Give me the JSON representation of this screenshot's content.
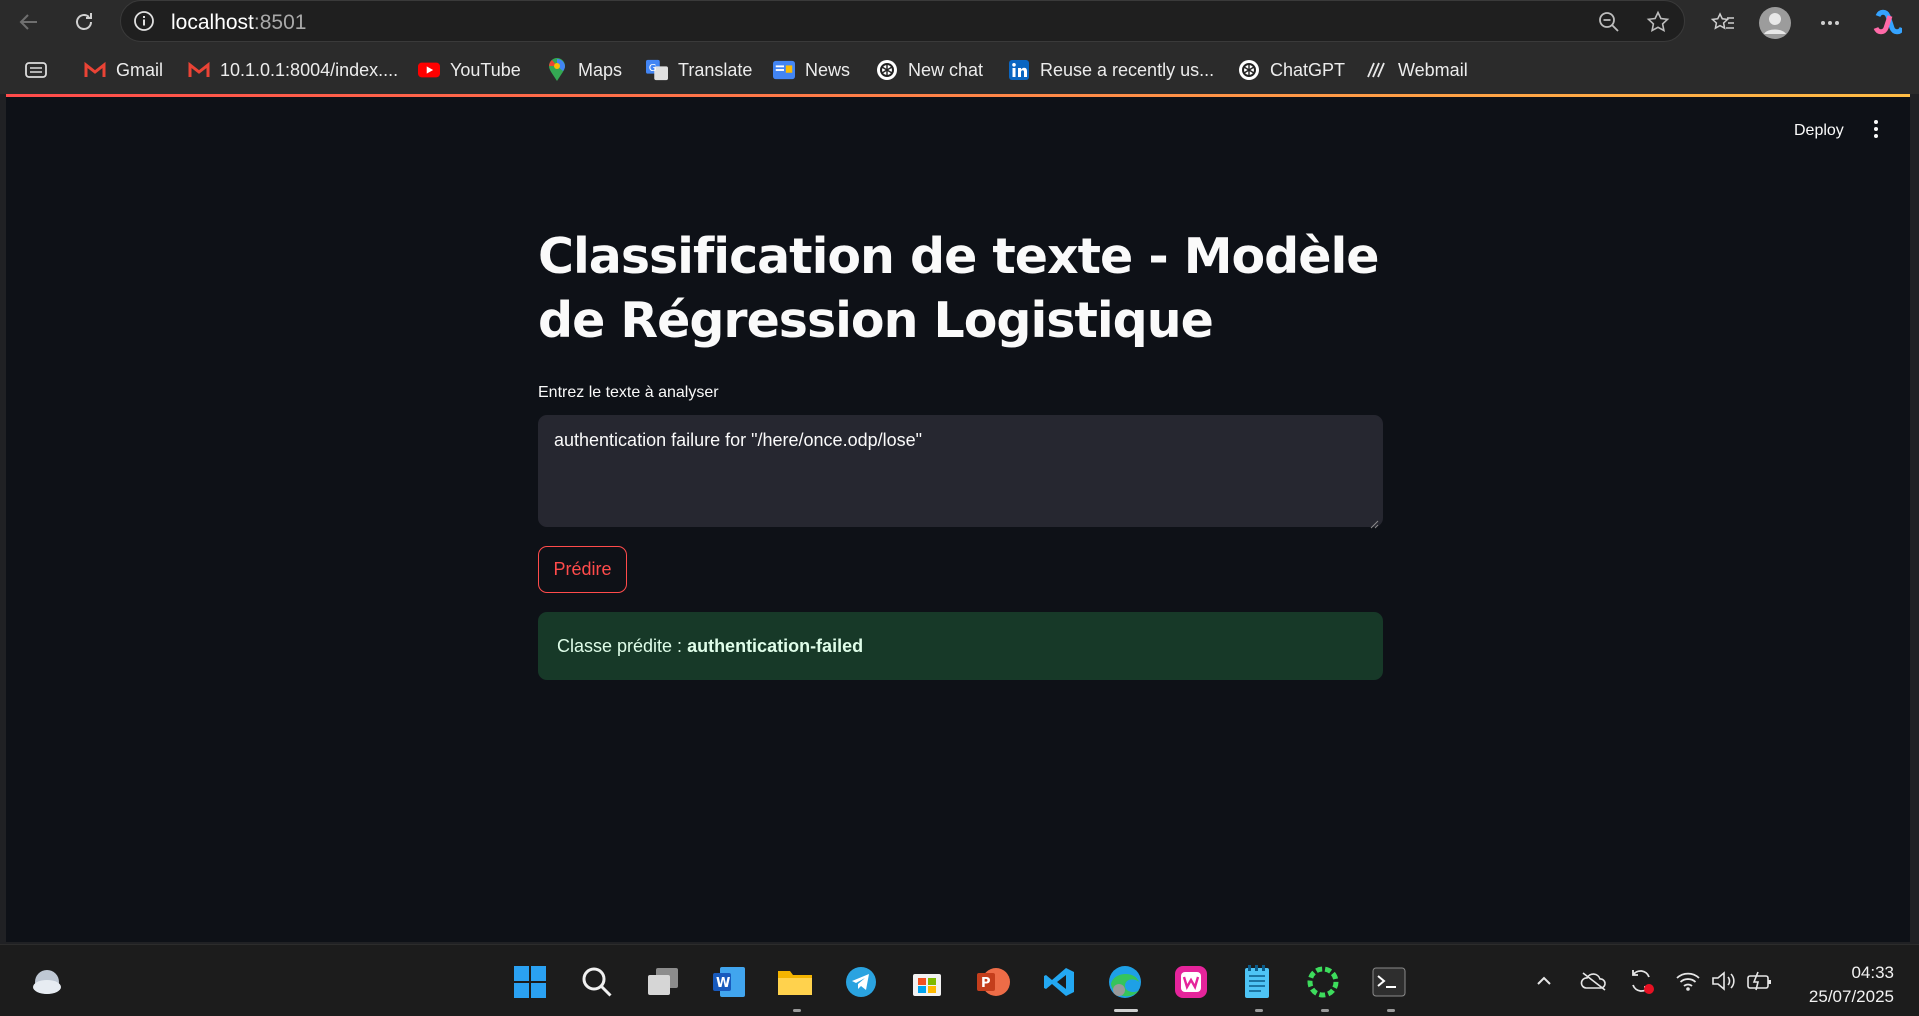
{
  "browser": {
    "url_host": "localhost",
    "url_port": ":8501"
  },
  "bookmarks": [
    {
      "label": "Gmail",
      "icon": "gmail-icon"
    },
    {
      "label": "10.1.0.1:8004/index....",
      "icon": "gmail-icon"
    },
    {
      "label": "YouTube",
      "icon": "youtube-icon"
    },
    {
      "label": "Maps",
      "icon": "maps-icon"
    },
    {
      "label": "Translate",
      "icon": "translate-icon"
    },
    {
      "label": "News",
      "icon": "news-icon"
    },
    {
      "label": "New chat",
      "icon": "openai-icon"
    },
    {
      "label": "Reuse a recently us...",
      "icon": "linkedin-icon"
    },
    {
      "label": "ChatGPT",
      "icon": "openai-icon"
    },
    {
      "label": "Webmail",
      "icon": "webmail-icon"
    }
  ],
  "app": {
    "deploy_label": "Deploy",
    "title": "Classification de texte - Modèle de Régression Logistique",
    "input_label": "Entrez le texte à analyser",
    "input_value": "authentication failure for \"/here/once.odp/lose\"",
    "predict_label": "Prédire",
    "result_prefix": "Classe prédite :",
    "result_value": "authentication-failed"
  },
  "taskbar": {
    "time": "04:33",
    "date": "25/07/2025"
  }
}
